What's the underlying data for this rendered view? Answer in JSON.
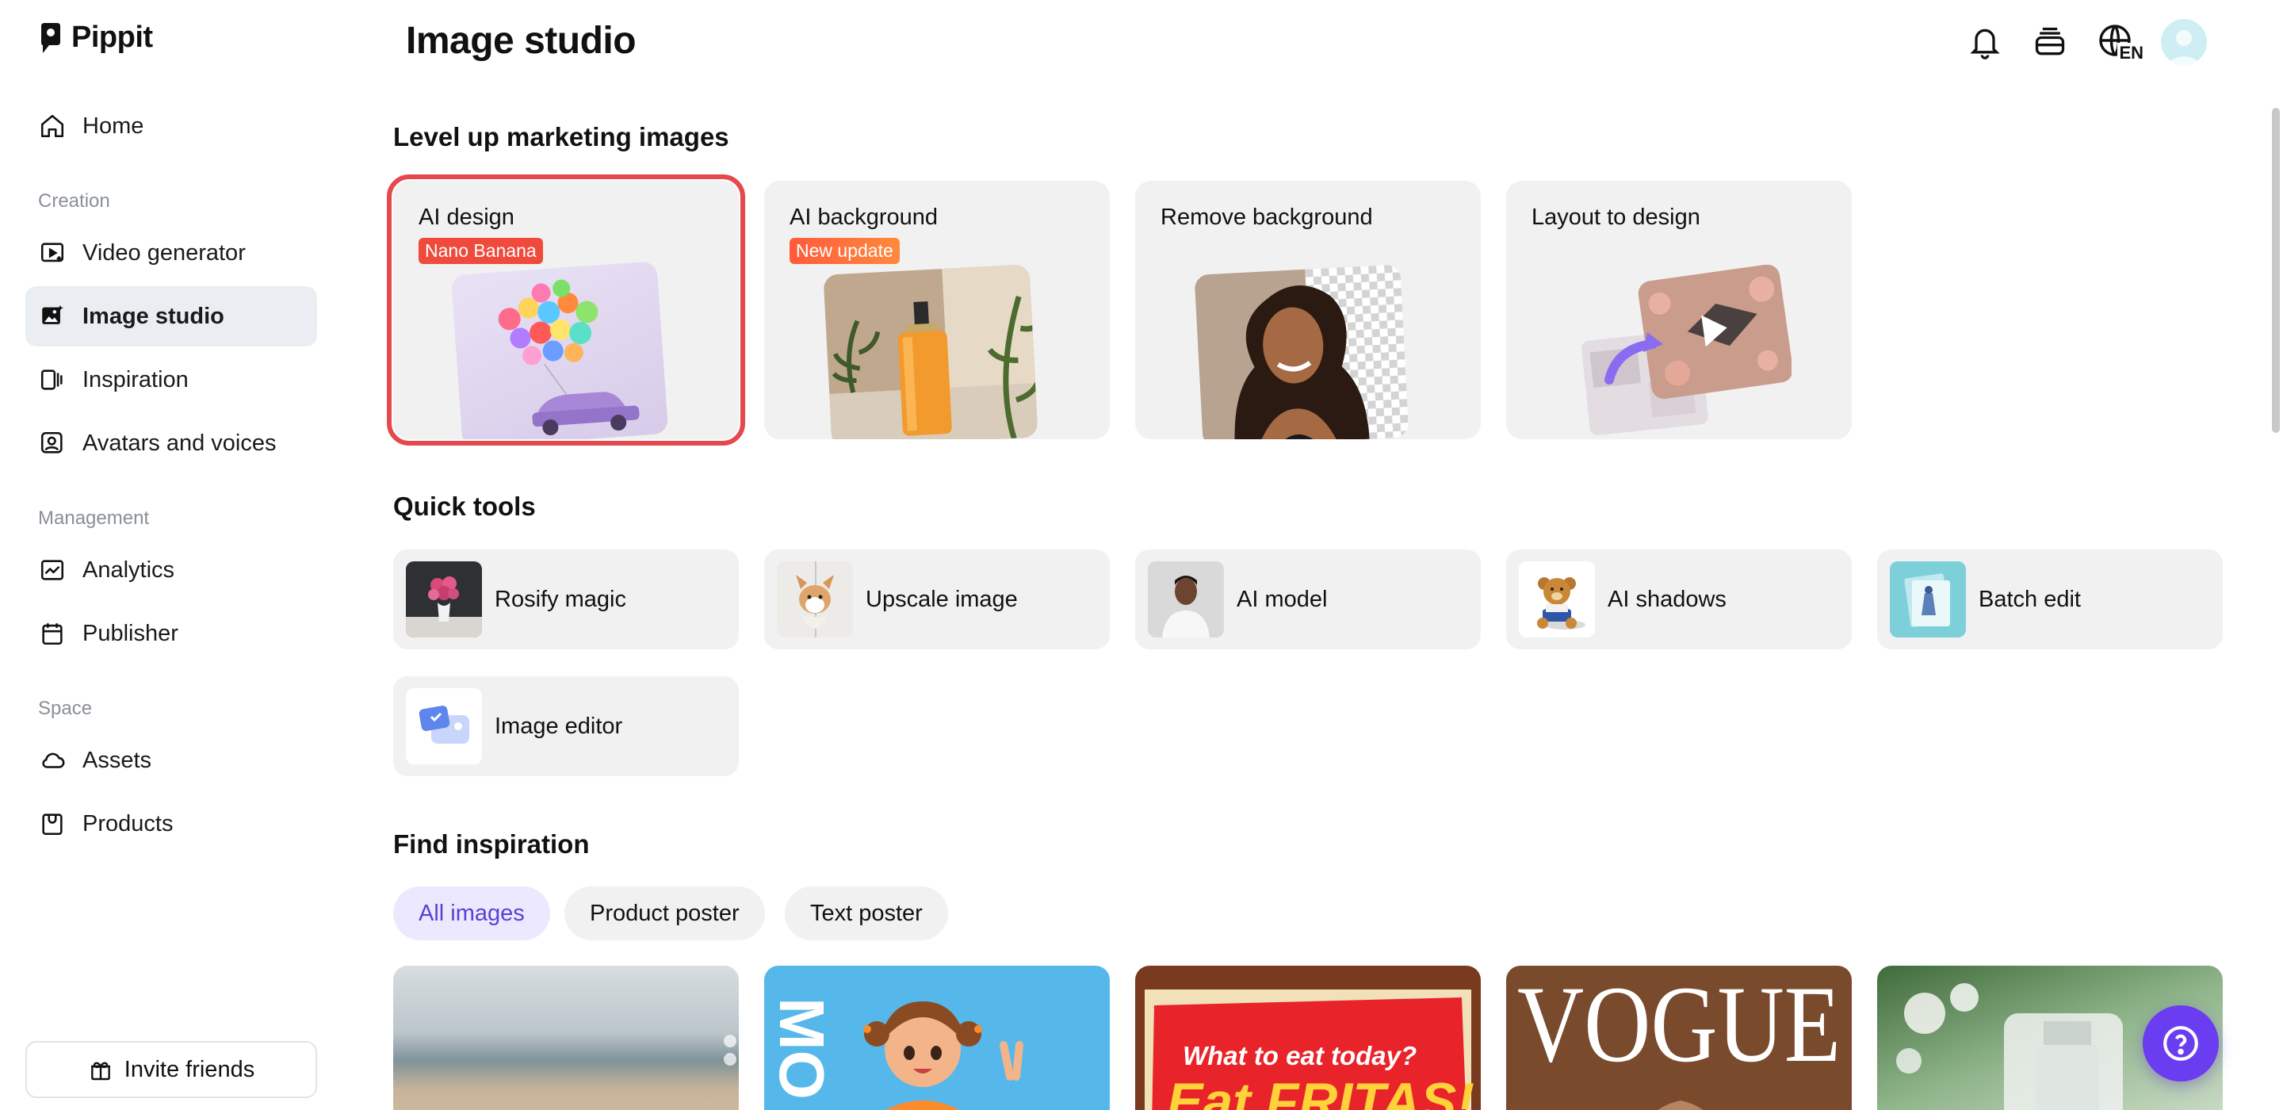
{
  "app": {
    "name": "Pippit"
  },
  "header": {
    "title": "Image studio",
    "lang": "EN"
  },
  "sidebar": {
    "home": "Home",
    "sections": {
      "creation": "Creation",
      "management": "Management",
      "space": "Space"
    },
    "items": {
      "video_generator": "Video generator",
      "image_studio": "Image studio",
      "inspiration": "Inspiration",
      "avatars_voices": "Avatars and voices",
      "analytics": "Analytics",
      "publisher": "Publisher",
      "assets": "Assets",
      "products": "Products"
    },
    "active_item": "Image studio",
    "invite": "Invite friends"
  },
  "marketing": {
    "title": "Level up marketing images",
    "cards": [
      {
        "label": "AI design",
        "badge": "Nano Banana"
      },
      {
        "label": "AI background",
        "badge": "New update"
      },
      {
        "label": "Remove background"
      },
      {
        "label": "Layout to design"
      }
    ]
  },
  "quick_tools": {
    "title": "Quick tools",
    "items": [
      "Rosify magic",
      "Upscale image",
      "AI model",
      "AI shadows",
      "Batch edit",
      "Image editor"
    ]
  },
  "inspiration": {
    "title": "Find inspiration",
    "filters": [
      "All images",
      "Product poster",
      "Text poster"
    ],
    "active_filter": "All images",
    "previews": {
      "text_a": "MO",
      "text_b": "What to eat today?",
      "text_c": "Eat FRITAS!",
      "text_d": "VOGUE"
    }
  },
  "colors": {
    "accent": "#6a3df0",
    "selection": "#e5484d",
    "badge_red": "#ef4a3c",
    "chip_active_bg": "#ece9ff",
    "chip_active_text": "#5a3fd6"
  }
}
